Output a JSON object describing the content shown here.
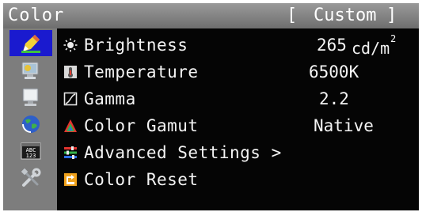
{
  "header": {
    "title": "Color",
    "bracket_open": "[",
    "mode": "Custom",
    "bracket_close": "]"
  },
  "sidebar": {
    "items": [
      {
        "name": "color",
        "icon": "color-pencil-icon",
        "selected": true
      },
      {
        "name": "screen",
        "icon": "screen-settings-icon",
        "selected": false
      },
      {
        "name": "powermanager",
        "icon": "power-manager-icon",
        "selected": false
      },
      {
        "name": "eco",
        "icon": "eco-globe-icon",
        "selected": false
      },
      {
        "name": "language",
        "icon": "language-abc-icon",
        "selected": false
      },
      {
        "name": "tools",
        "icon": "tools-icon",
        "selected": false
      }
    ]
  },
  "menu": {
    "items": [
      {
        "label": "Brightness",
        "icon": "brightness-sun-icon",
        "value": "265",
        "unit": "cd/m",
        "unit_sup": "2"
      },
      {
        "label": "Temperature",
        "icon": "temperature-icon",
        "value": "6500K"
      },
      {
        "label": "Gamma",
        "icon": "gamma-icon",
        "value": "2.2"
      },
      {
        "label": "Color Gamut",
        "icon": "color-gamut-icon",
        "value": "Native"
      },
      {
        "label": "Advanced Settings >",
        "icon": "advanced-settings-icon"
      },
      {
        "label": "Color Reset",
        "icon": "color-reset-icon"
      }
    ]
  },
  "colors": {
    "background": "#050505",
    "title_bar": "#8a8a8a",
    "sidebar": "#7d7d7d",
    "selection": "#1a1acf",
    "text": "#f4f4f4"
  }
}
